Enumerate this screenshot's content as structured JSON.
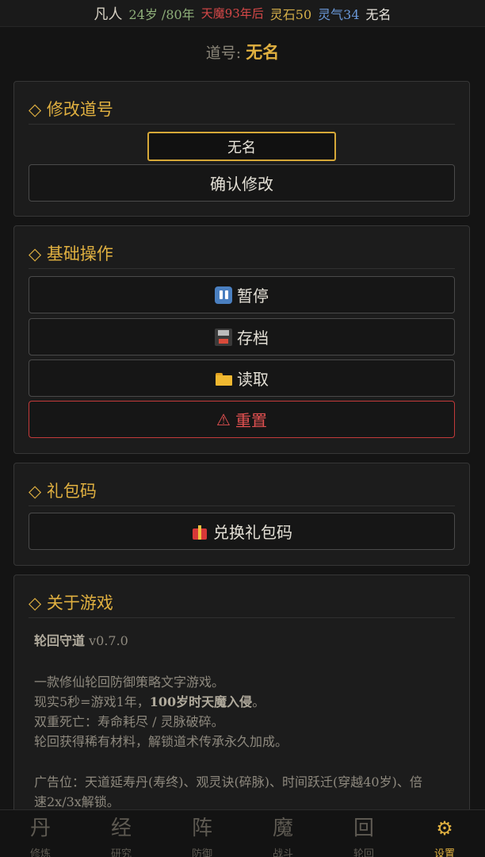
{
  "status": {
    "rank": "凡人",
    "age": "24岁",
    "lifespan": "/80年",
    "demon": "天魔93年后",
    "stones": "灵石50",
    "qi": "灵气34",
    "name": "无名"
  },
  "daohao": {
    "label": "道号:",
    "value": "无名"
  },
  "rename": {
    "title": "◇ 修改道号",
    "input_value": "无名",
    "confirm_label": "确认修改"
  },
  "basic": {
    "title": "◇ 基础操作",
    "pause_label": "暂停",
    "save_label": "存档",
    "load_label": "读取",
    "reset_label": "重置",
    "reset_icon": "⚠"
  },
  "gift": {
    "title": "◇ 礼包码",
    "redeem_label": "兑换礼包码"
  },
  "about": {
    "title": "◇ 关于游戏",
    "game_name": "轮回守道",
    "version": " v0.7.0",
    "desc_line1": "一款修仙轮回防御策略文字游戏。",
    "desc_line2_a": "现实5秒=游戏1年，",
    "desc_line2_b": "100岁时天魔入侵",
    "desc_line2_c": "。",
    "desc_line3": "双重死亡：寿命耗尽 / 灵脉破碎。",
    "desc_line4": "轮回获得稀有材料，解锁道术传承永久加成。",
    "ad_line1": "广告位：天道延寿丹(寿终)、观灵诀(碎脉)、时间跃迁(穿越40岁)、倍",
    "ad_line2": "速2x/3x解锁。"
  },
  "tabs": [
    {
      "glyph": "丹",
      "label": "修炼"
    },
    {
      "glyph": "经",
      "label": "研究"
    },
    {
      "glyph": "阵",
      "label": "防御"
    },
    {
      "glyph": "魔",
      "label": "战斗"
    },
    {
      "glyph": "回",
      "label": "轮回"
    },
    {
      "glyph": "⚙",
      "label": "设置"
    }
  ],
  "colors": {
    "accent": "#e0b040",
    "danger": "#d64848",
    "background": "#141414"
  }
}
